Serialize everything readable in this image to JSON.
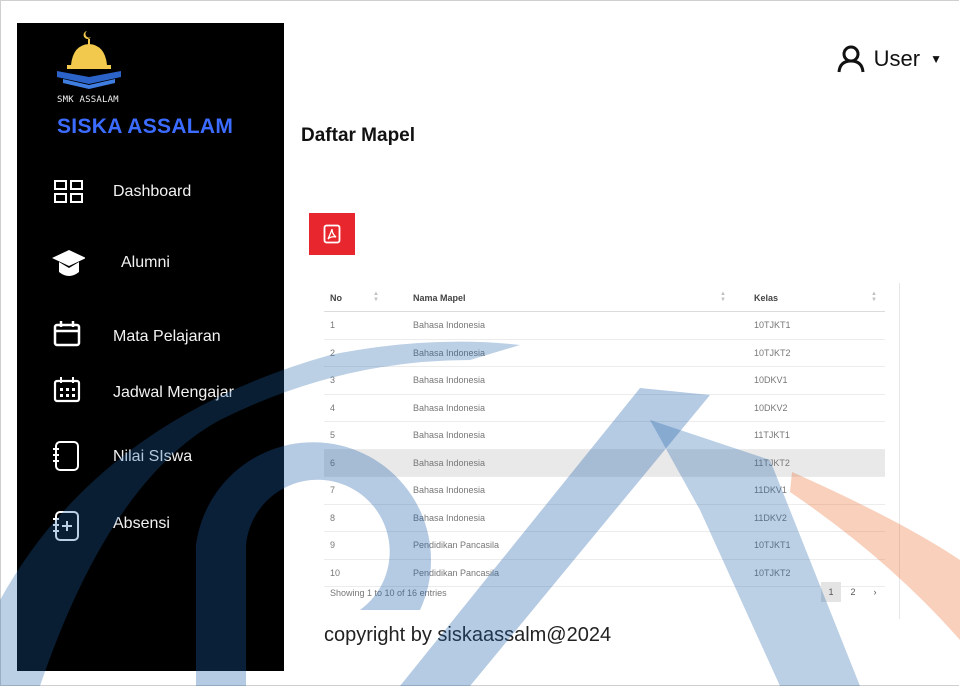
{
  "sidebar": {
    "logo_text": "SMK ASSALAM",
    "brand": "SISKA ASSALAM",
    "items": [
      {
        "label": "Dashboard",
        "icon": "dashboard-grid-icon"
      },
      {
        "label": "Alumni",
        "icon": "graduation-cap-icon"
      },
      {
        "label": "Mata Pelajaran",
        "icon": "calendar-icon"
      },
      {
        "label": "Jadwal Mengajar",
        "icon": "calendar-grid-icon"
      },
      {
        "label": "Nilai SIswa",
        "icon": "notebook-icon"
      },
      {
        "label": "Absensi",
        "icon": "notebook-add-icon"
      }
    ]
  },
  "header": {
    "user_label": "User"
  },
  "page": {
    "title": "Daftar Mapel"
  },
  "table": {
    "columns": [
      "No",
      "Nama Mapel",
      "Kelas"
    ],
    "rows": [
      [
        "1",
        "Bahasa Indonesia",
        "10TJKT1"
      ],
      [
        "2",
        "Bahasa Indonesia",
        "10TJKT2"
      ],
      [
        "3",
        "Bahasa Indonesia",
        "10DKV1"
      ],
      [
        "4",
        "Bahasa Indonesia",
        "10DKV2"
      ],
      [
        "5",
        "Bahasa Indonesia",
        "11TJKT1"
      ],
      [
        "6",
        "Bahasa Indonesia",
        "11TJKT2"
      ],
      [
        "7",
        "Bahasa Indonesia",
        "11DKV1"
      ],
      [
        "8",
        "Bahasa Indonesia",
        "11DKV2"
      ],
      [
        "9",
        "Pendidikan Pancasila",
        "10TJKT1"
      ],
      [
        "10",
        "Pendidikan Pancasila",
        "10TJKT2"
      ]
    ],
    "info": "Showing 1 to 10 of 16 entries",
    "pages": [
      "1",
      "2"
    ],
    "next": "›"
  },
  "footer": {
    "copyright": "copyright by siskaassalm@2024"
  },
  "colors": {
    "sidebar_bg": "#000000",
    "brand": "#3b6bff",
    "pdf_button": "#e8262d",
    "watermark_blue": "#1d5fa9",
    "watermark_orange": "#e8651e"
  }
}
